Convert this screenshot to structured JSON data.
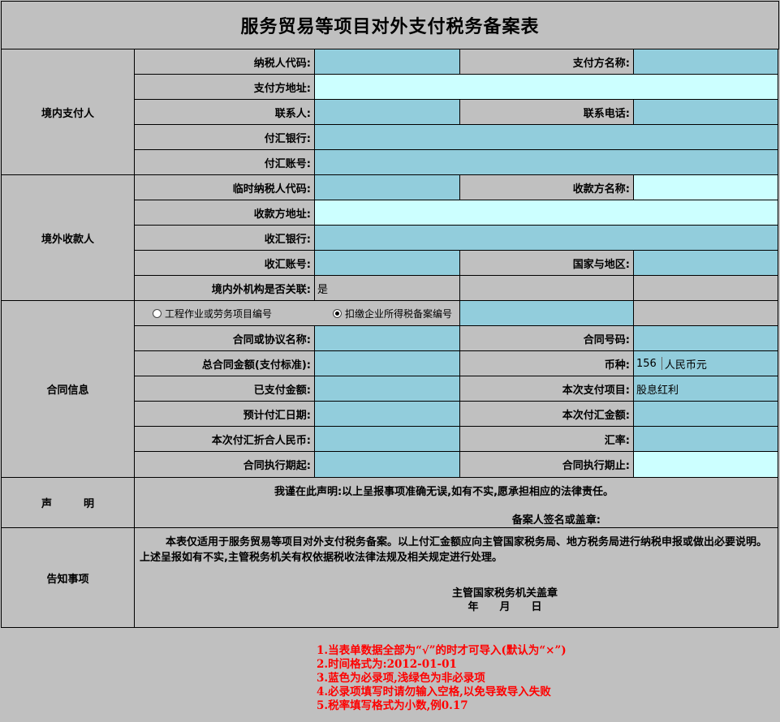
{
  "title": "服务贸易等项目对外支付税务备案表",
  "sections": {
    "domestic_payer": "境内支付人",
    "foreign_payee": "境外收款人",
    "contract_info": "合同信息",
    "declaration": "声　　　明",
    "notice": "告知事项"
  },
  "labels": {
    "taxpayer_code": "纳税人代码:",
    "payer_name": "支付方名称:",
    "payer_address": "支付方地址:",
    "contact": "联系人:",
    "contact_phone": "联系电话:",
    "remit_bank": "付汇银行:",
    "remit_account": "付汇账号:",
    "temp_taxpayer_code": "临时纳税人代码:",
    "payee_name": "收款方名称:",
    "payee_address": "收款方地址:",
    "receive_bank": "收汇银行:",
    "receive_account": "收汇账号:",
    "country_region": "国家与地区:",
    "related": "境内外机构是否关联:",
    "contract_name": "合同或协议名称:",
    "contract_no": "合同号码:",
    "total_amount": "总合同金额(支付标准):",
    "currency": "币种:",
    "paid_amount": "已支付金额:",
    "payment_item": "本次支付项目:",
    "expected_date": "预计付汇日期:",
    "current_amount": "本次付汇金额:",
    "rmb_equivalent": "本次付汇折合人民币:",
    "exchange_rate": "汇率:",
    "start_date": "合同执行期起:",
    "end_date": "合同执行期止:"
  },
  "radios": {
    "project_option": "工程作业或劳务项目编号",
    "withholding_option": "扣缴企业所得税备案编号",
    "selected": "withholding_option"
  },
  "values": {
    "related": "是",
    "currency_code": "156",
    "currency_name": "人民币元",
    "payment_item": "股息红利"
  },
  "declaration": {
    "text": "我谨在此声明:以上呈报事项准确无误,如有不实,愿承担相应的法律责任。",
    "signature": "备案人签名或盖章:"
  },
  "notice": {
    "text": "本表仅适用于服务贸易等项目对外支付税务备案。以上付汇金额应向主管国家税务局、地方税务局进行纳税申报或做出必要说明。上述呈报如有不实,主管税务机关有权依据税收法律法规及相关规定进行处理。",
    "seal": "主管国家税务机关盖章",
    "date": "年　　月　　日"
  },
  "notes": [
    "1.当表单数据全部为“√”的时才可导入(默认为“×”)",
    "2.时间格式为:2012-01-01",
    "3.蓝色为必录项,浅绿色为非必录项",
    "4.必录项填写时请勿输入空格,以免导致导入失败",
    "5.税率填写格式为小数,例0.17"
  ],
  "colors": {
    "required": "#92cddc",
    "optional": "#ccffff",
    "background": "#c0c0c0",
    "note_text": "#ff0000"
  }
}
